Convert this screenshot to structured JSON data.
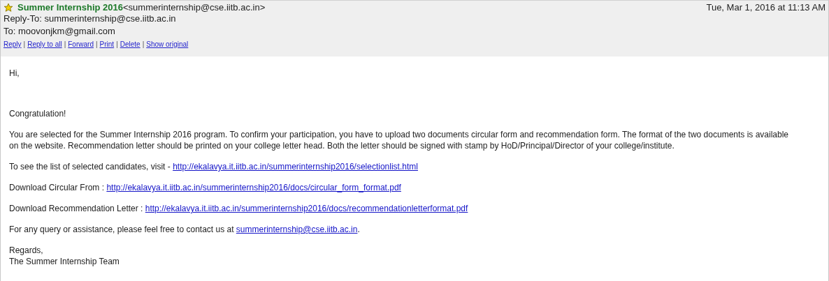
{
  "header": {
    "starred": true,
    "sender_name": "Summer Internship 2016",
    "sender_address": "<summerinternship@cse.iitb.ac.in>",
    "date": "Tue, Mar 1, 2016 at 11:13 AM",
    "reply_to": "Reply-To: summerinternship@cse.iitb.ac.in",
    "to": "To: moovonjkm@gmail.com",
    "actions": [
      "Reply",
      "Reply to all",
      "Forward",
      "Print",
      "Delete",
      "Show original"
    ],
    "separator": "|"
  },
  "body": {
    "greeting": "Hi,",
    "paragraphs": [
      {
        "kind": "text",
        "text": "Congratulation!"
      },
      {
        "kind": "text",
        "text": "You are selected for the Summer Internship 2016 program. To confirm your participation, you have to upload two documents circular form and recommendation form. The format of the two documents is available on the website. Recommendation letter should be printed on your college letter head. Both the letter should be signed with stamp by HoD/Principal/Director of your college/institute."
      },
      {
        "kind": "link",
        "text": "To see the list of selected candidates, visit - ",
        "link": "http://ekalavya.it.iitb.ac.in/summerinternship2016/selectionlist.html"
      },
      {
        "kind": "link",
        "text": "Download Circular From : ",
        "link": "http://ekalavya.it.iitb.ac.in/summerinternship2016/docs/circular_form_format.pdf"
      },
      {
        "kind": "link",
        "text": "Download Recommendation Letter : ",
        "link": "http://ekalavya.it.iitb.ac.in/summerinternship2016/docs/recommendationletterformat.pdf"
      },
      {
        "kind": "link",
        "text": "For any query or assistance, please feel free to contact us at ",
        "link": "summerinternship@cse.iitb.ac.in",
        "after": "."
      }
    ],
    "signoff": [
      "Regards,",
      "The Summer Internship Team"
    ]
  }
}
